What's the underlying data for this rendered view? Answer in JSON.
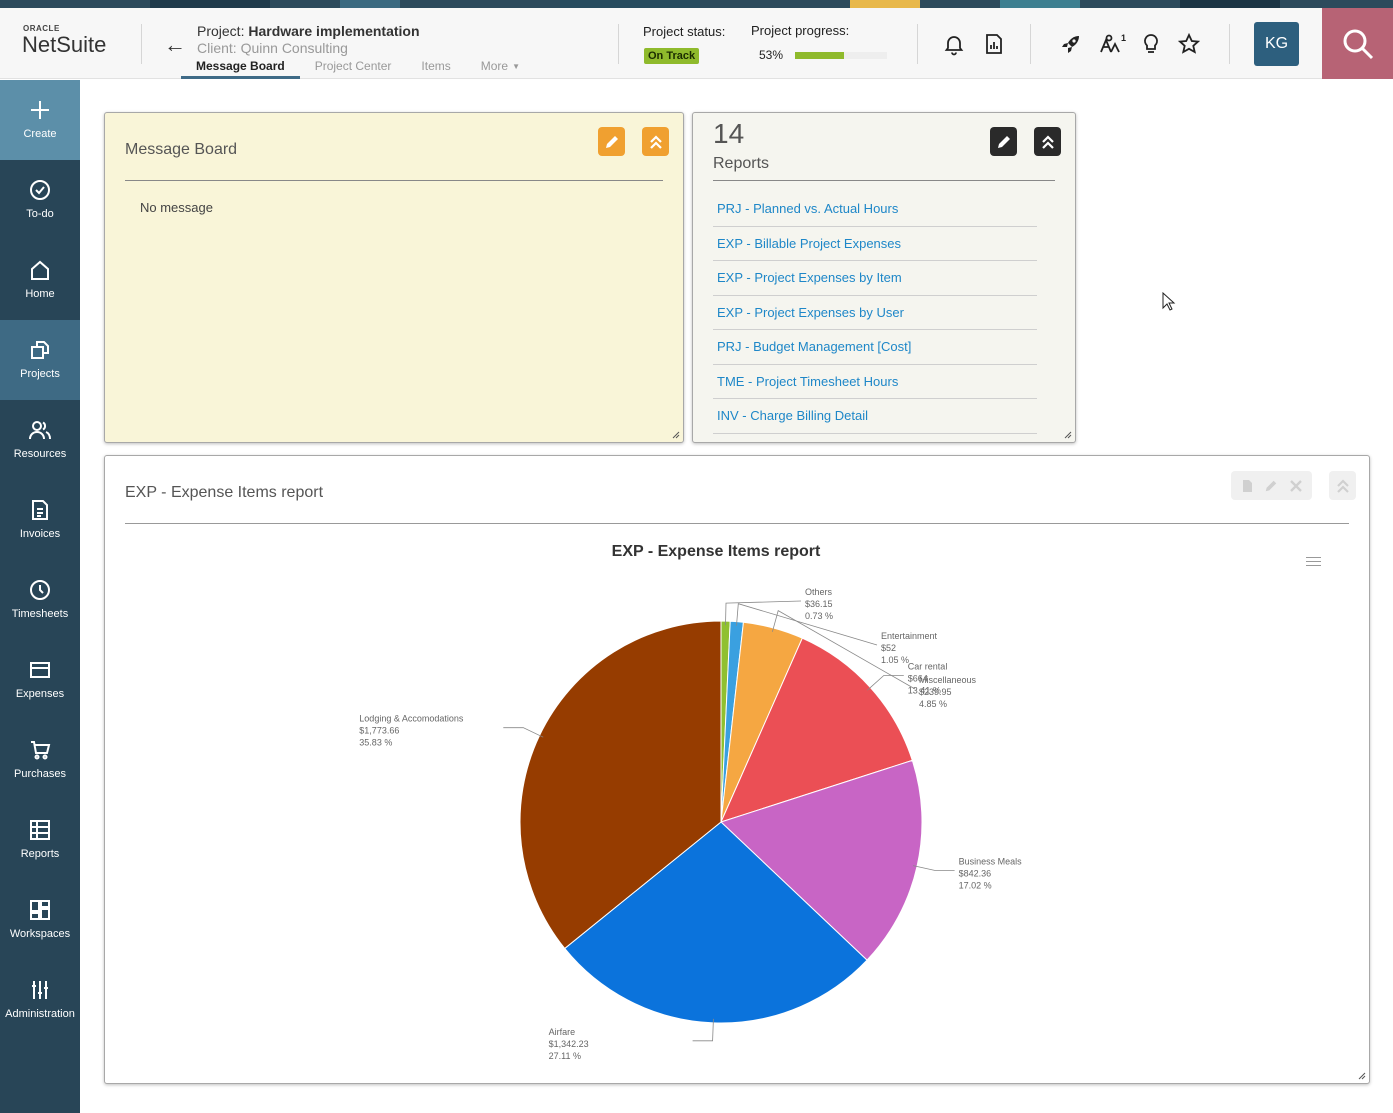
{
  "header": {
    "logo_top": "ORACLE",
    "logo_main": "NetSuite",
    "project_prefix": "Project: ",
    "project_name": "Hardware implementation",
    "client": "Client: Quinn Consulting",
    "tabs": [
      {
        "label": "Message Board"
      },
      {
        "label": "Project Center"
      },
      {
        "label": "Items"
      },
      {
        "label": "More"
      }
    ],
    "status_label": "Project status:",
    "status_value": "On Track",
    "progress_label": "Project progress:",
    "progress_value": "53%",
    "progress_fraction": 0.53,
    "avatar": "KG",
    "icons": [
      "bell-icon",
      "report-chart-icon",
      "rocket-icon",
      "sparkle-notification-icon",
      "lightbulb-icon",
      "star-icon",
      "search-icon"
    ],
    "notification_count": "1"
  },
  "sidebar": {
    "items": [
      {
        "label": "Create",
        "icon": "plus-icon"
      },
      {
        "label": "To-do",
        "icon": "check-circle-icon"
      },
      {
        "label": "Home",
        "icon": "home-icon"
      },
      {
        "label": "Projects",
        "icon": "projects-icon"
      },
      {
        "label": "Resources",
        "icon": "people-icon"
      },
      {
        "label": "Invoices",
        "icon": "invoice-icon"
      },
      {
        "label": "Timesheets",
        "icon": "clock-icon"
      },
      {
        "label": "Expenses",
        "icon": "card-icon"
      },
      {
        "label": "Purchases",
        "icon": "cart-icon"
      },
      {
        "label": "Reports",
        "icon": "table-icon"
      },
      {
        "label": "Workspaces",
        "icon": "workspaces-icon"
      },
      {
        "label": "Administration",
        "icon": "sliders-icon"
      }
    ]
  },
  "message_board": {
    "title": "Message Board",
    "empty_text": "No message"
  },
  "reports": {
    "count": "14",
    "title": "Reports",
    "items": [
      "PRJ - Planned vs. Actual Hours",
      "EXP - Billable Project Expenses",
      "EXP - Project Expenses by Item",
      "EXP - Project Expenses by User",
      "PRJ - Budget Management [Cost]",
      "TME - Project Timesheet Hours",
      "INV - Charge Billing Detail"
    ]
  },
  "expense_portlet": {
    "title": "EXP - Expense Items report"
  },
  "colors": {
    "sidebar": "#284557",
    "accent": "#f0a030",
    "link": "#1e87c8",
    "on_track": "#8fba2c"
  },
  "chart_data": {
    "type": "pie",
    "title": "EXP - Expense Items report",
    "slices": [
      {
        "label": "Others",
        "amount": "$36.15",
        "percent_text": "0.73 %",
        "value": 36.15,
        "percent": 0.73,
        "color": "#90c030"
      },
      {
        "label": "Entertainment",
        "amount": "$52",
        "percent_text": "1.05 %",
        "value": 52,
        "percent": 1.05,
        "color": "#3aa0e0"
      },
      {
        "label": "Miscellaneous",
        "amount": "$239.95",
        "percent_text": "4.85 %",
        "value": 239.95,
        "percent": 4.85,
        "color": "#f5a742"
      },
      {
        "label": "Car rental",
        "amount": "$664",
        "percent_text": "13.41 %",
        "value": 664,
        "percent": 13.41,
        "color": "#eb4f55"
      },
      {
        "label": "Business Meals",
        "amount": "$842.36",
        "percent_text": "17.02 %",
        "value": 842.36,
        "percent": 17.02,
        "color": "#c865c5"
      },
      {
        "label": "Airfare",
        "amount": "$1,342.23",
        "percent_text": "27.11 %",
        "value": 1342.23,
        "percent": 27.11,
        "color": "#0b73dc"
      },
      {
        "label": "Lodging & Accomodations",
        "amount": "$1,773.66",
        "percent_text": "35.83 %",
        "value": 1773.66,
        "percent": 35.83,
        "color": "#963c00"
      }
    ]
  }
}
